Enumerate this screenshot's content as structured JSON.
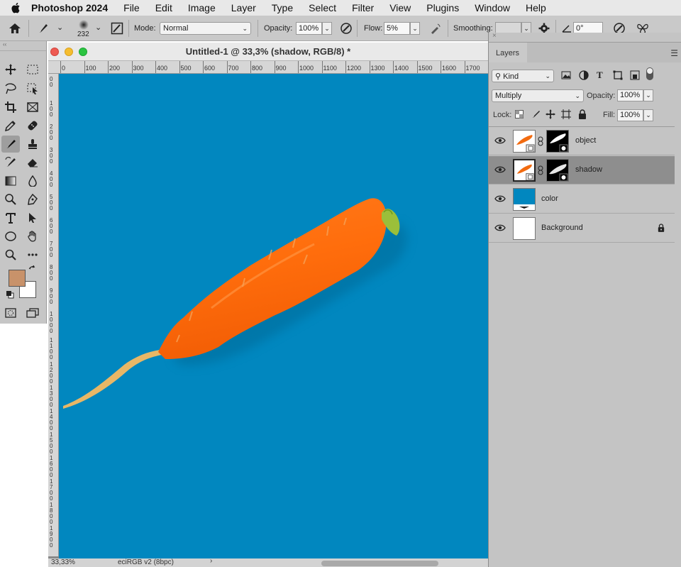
{
  "menubar": {
    "app_name": "Photoshop 2024",
    "items": [
      "File",
      "Edit",
      "Image",
      "Layer",
      "Type",
      "Select",
      "Filter",
      "View",
      "Plugins",
      "Window",
      "Help"
    ]
  },
  "options": {
    "brush_size": "232",
    "mode_label": "Mode:",
    "mode_value": "Normal",
    "opacity_label": "Opacity:",
    "opacity_value": "100%",
    "flow_label": "Flow:",
    "flow_value": "5%",
    "smoothing_label": "Smoothing:",
    "angle_value": "0°"
  },
  "document": {
    "title": "Untitled-1 @ 33,3% (shadow, RGB/8) *",
    "ruler_ticks": [
      "0",
      "100",
      "200",
      "300",
      "400",
      "500",
      "600",
      "700",
      "800",
      "900",
      "1000",
      "1100",
      "1200",
      "1300",
      "1400",
      "1500",
      "1600",
      "1700"
    ],
    "zoom": "33,33%",
    "color_profile": "eciRGB v2 (8bpc)",
    "canvas_color": "#0187bf"
  },
  "layers_panel": {
    "tab_label": "Layers",
    "kind_label": "Kind",
    "blend_mode": "Multiply",
    "opacity_label": "Opacity:",
    "opacity_value": "100%",
    "lock_label": "Lock:",
    "fill_label": "Fill:",
    "fill_value": "100%",
    "layers": [
      {
        "name": "object",
        "selected": false
      },
      {
        "name": "shadow",
        "selected": true
      },
      {
        "name": "color",
        "selected": false
      },
      {
        "name": "Background",
        "selected": false
      }
    ]
  },
  "tools": {
    "foreground_color": "#c8926a",
    "background_color": "#ffffff"
  }
}
